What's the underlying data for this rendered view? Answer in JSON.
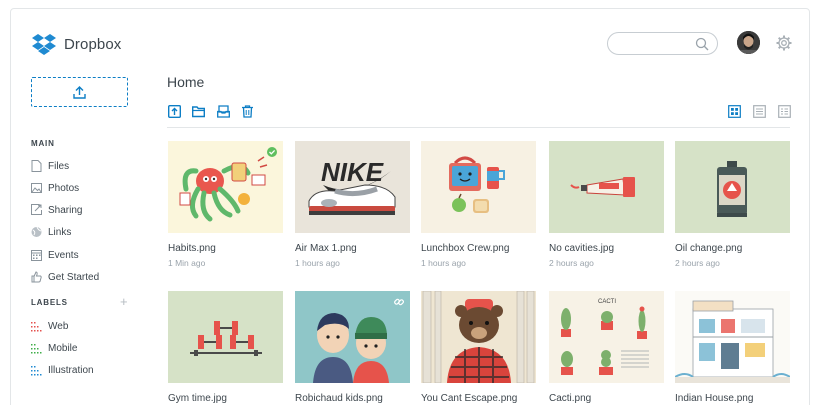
{
  "app": {
    "name": "Dropbox"
  },
  "search": {
    "placeholder": "",
    "value": ""
  },
  "page": {
    "title": "Home"
  },
  "sidebar": {
    "main_heading": "MAIN",
    "main_items": [
      {
        "label": "Files",
        "icon": "file-icon"
      },
      {
        "label": "Photos",
        "icon": "photo-icon"
      },
      {
        "label": "Sharing",
        "icon": "share-icon"
      },
      {
        "label": "Links",
        "icon": "link-icon"
      },
      {
        "label": "Events",
        "icon": "calendar-icon"
      },
      {
        "label": "Get Started",
        "icon": "hand-icon"
      }
    ],
    "labels_heading": "LABELS",
    "add_label": "+",
    "label_items": [
      {
        "label": "Web",
        "color": "#e4504d"
      },
      {
        "label": "Mobile",
        "color": "#3fae49"
      },
      {
        "label": "Illustration",
        "color": "#1f8ad1"
      }
    ]
  },
  "colors": {
    "accent": "#0d7ec5",
    "text": "#3d464d",
    "muted": "#9aa3ab"
  },
  "files": [
    {
      "name": "Habits.png",
      "date": "1 Min ago",
      "synced": true
    },
    {
      "name": "Air Max 1.png",
      "date": "1 hours ago"
    },
    {
      "name": "Lunchbox Crew.png",
      "date": "1 hours ago"
    },
    {
      "name": "No cavities.jpg",
      "date": "2 hours ago"
    },
    {
      "name": "Oil change.png",
      "date": "2 hours ago"
    },
    {
      "name": "Gym time.jpg",
      "date": ""
    },
    {
      "name": "Robichaud kids.png",
      "date": "",
      "shared": true
    },
    {
      "name": "You Cant Escape.png",
      "date": ""
    },
    {
      "name": "Cacti.png",
      "date": ""
    },
    {
      "name": "Indian House.png",
      "date": ""
    }
  ],
  "thumb_text": {
    "cacti_title": "CACTI"
  }
}
